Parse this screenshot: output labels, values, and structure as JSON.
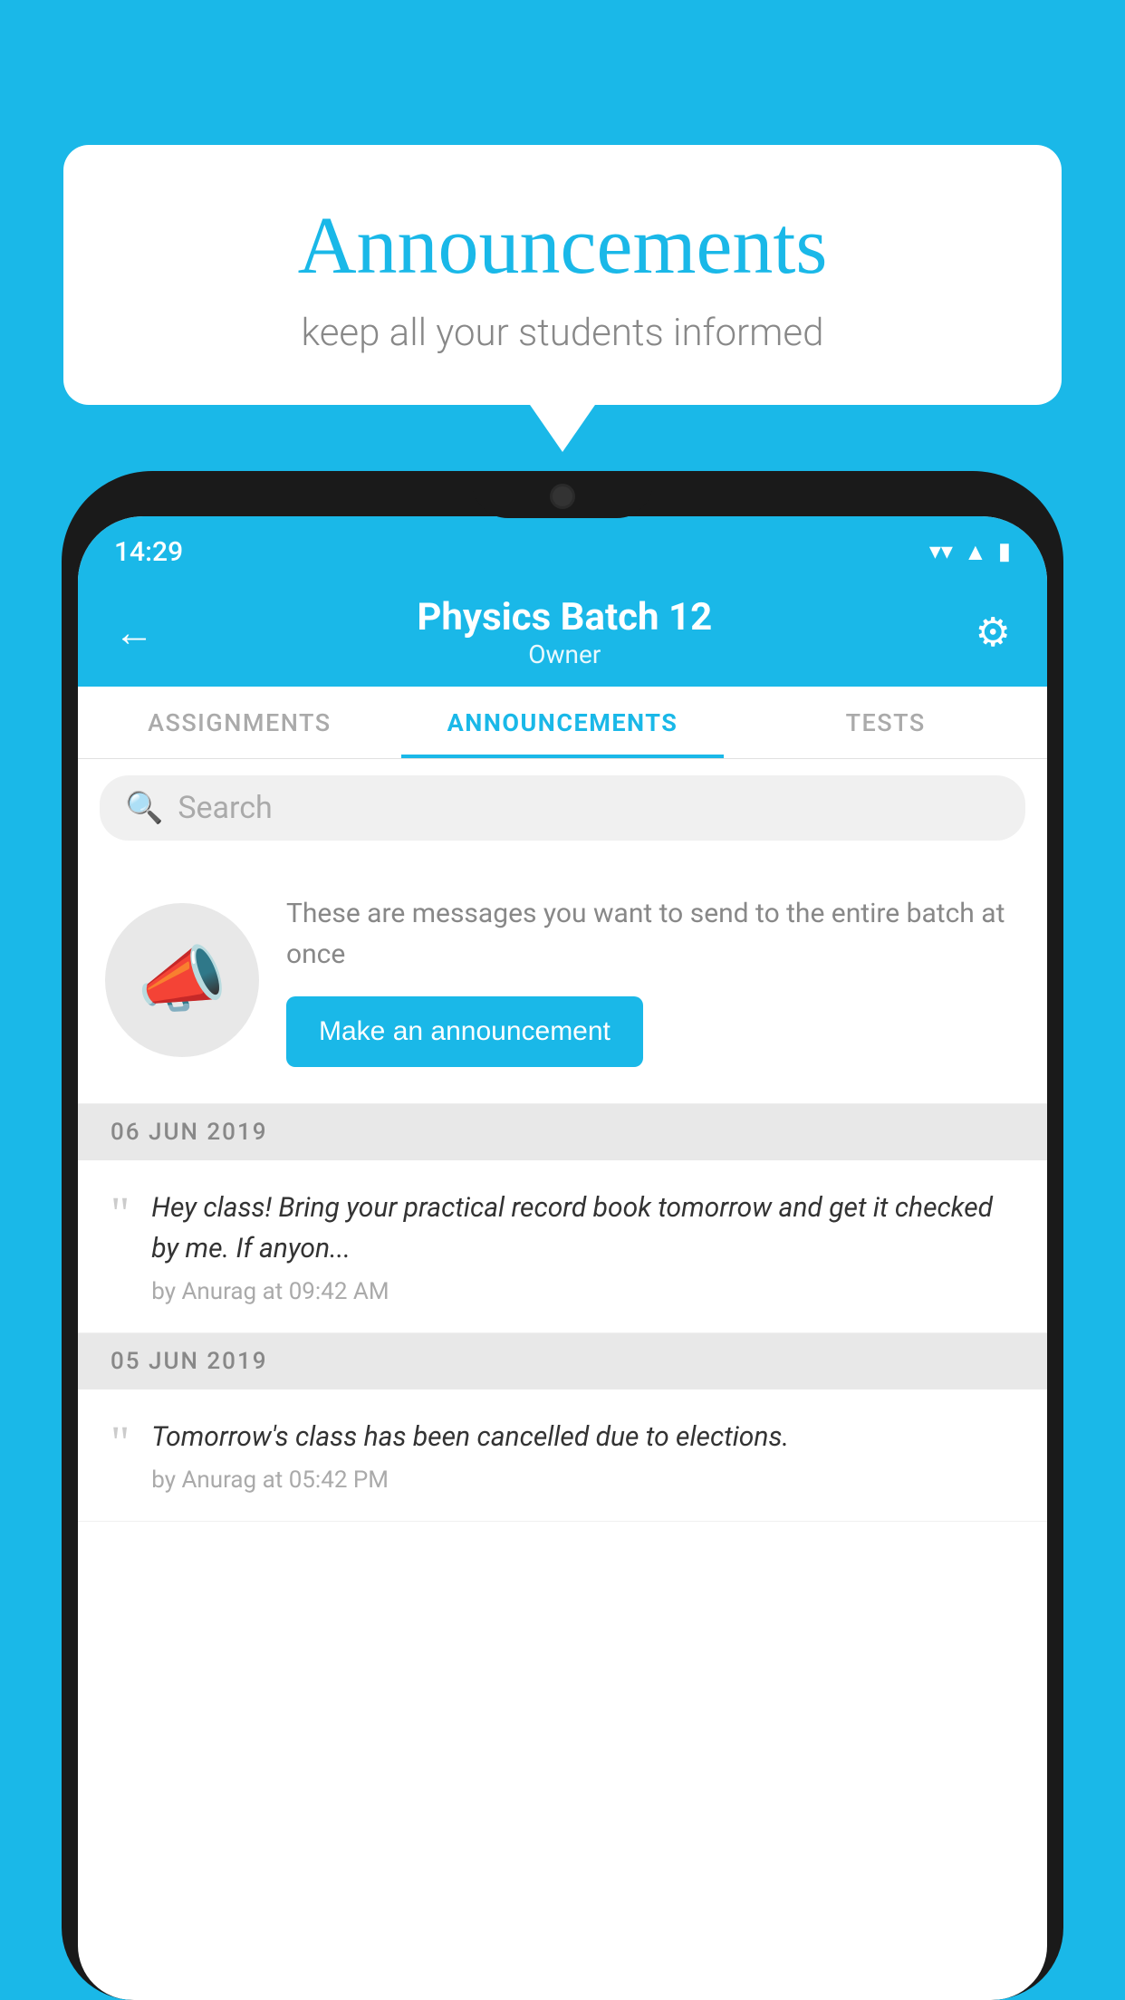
{
  "background_color": "#1ab8e8",
  "speech_bubble": {
    "title": "Announcements",
    "subtitle": "keep all your students informed"
  },
  "phone": {
    "status_bar": {
      "time": "14:29",
      "icons": [
        "wifi",
        "signal",
        "battery"
      ]
    },
    "header": {
      "back_label": "←",
      "title": "Physics Batch 12",
      "subtitle": "Owner",
      "settings_label": "⚙"
    },
    "tabs": [
      {
        "label": "ASSIGNMENTS",
        "active": false
      },
      {
        "label": "ANNOUNCEMENTS",
        "active": true
      },
      {
        "label": "TESTS",
        "active": false
      },
      {
        "label": "...",
        "active": false
      }
    ],
    "search": {
      "placeholder": "Search"
    },
    "promo": {
      "description": "These are messages you want to send to the entire batch at once",
      "button_label": "Make an announcement"
    },
    "announcements": [
      {
        "date": "06  JUN  2019",
        "text": "Hey class! Bring your practical record book tomorrow and get it checked by me. If anyon...",
        "meta": "by Anurag at 09:42 AM"
      },
      {
        "date": "05  JUN  2019",
        "text": "Tomorrow's class has been cancelled due to elections.",
        "meta": "by Anurag at 05:42 PM"
      }
    ]
  }
}
